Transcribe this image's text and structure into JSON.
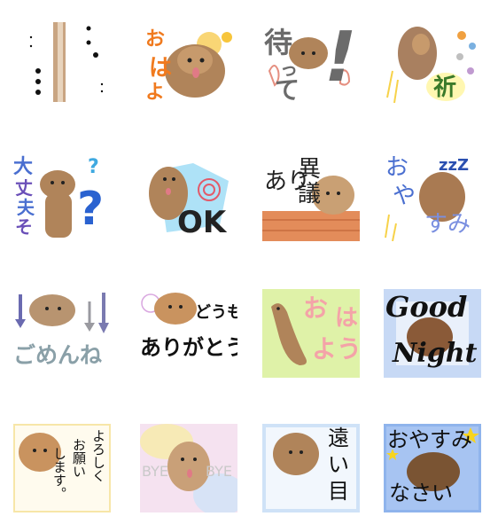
{
  "stickers": [
    {
      "id": "dots",
      "text": []
    },
    {
      "id": "ohayo",
      "text": [
        "お",
        "は",
        "よ"
      ]
    },
    {
      "id": "matte",
      "text": [
        "待",
        "っ",
        "て",
        "!"
      ]
    },
    {
      "id": "inori",
      "text": [
        "祈"
      ]
    },
    {
      "id": "daijoubu",
      "text": [
        "大",
        "丈",
        "夫",
        "そ",
        "?",
        "?"
      ]
    },
    {
      "id": "ok",
      "text": [
        "OK"
      ]
    },
    {
      "id": "igi",
      "text": [
        "異",
        "議",
        "あり"
      ]
    },
    {
      "id": "oyasumi",
      "text": [
        "お",
        "や",
        "すみ",
        "zzZ"
      ]
    },
    {
      "id": "gomenne",
      "text": [
        "ごめんね"
      ]
    },
    {
      "id": "arigatou",
      "text": [
        "どうも",
        "ありがとう"
      ]
    },
    {
      "id": "ohayou2",
      "text": [
        "お",
        "は",
        "よう"
      ]
    },
    {
      "id": "goodnight",
      "text": [
        "Good",
        "Night"
      ]
    },
    {
      "id": "yoroshiku",
      "text": [
        "よろしく",
        "お願い",
        "します。"
      ]
    },
    {
      "id": "byebye",
      "text": [
        "BYE",
        "BYE"
      ]
    },
    {
      "id": "tooime",
      "text": [
        "遠",
        "い",
        "目"
      ]
    },
    {
      "id": "oyasuminasai",
      "text": [
        "おやすみ",
        "なさい"
      ]
    }
  ],
  "colors": {
    "dog": "#b0845a",
    "dog_dark": "#7a5433",
    "ohayo_orange": "#f07a1e",
    "ohayo_yellow": "#f7c53b",
    "blue": "#4a6fd0",
    "purple": "#6a4fb8",
    "gray": "#7c7c7c",
    "green_bg": "#dff2a8",
    "sky": "#9fc9f0"
  },
  "icons": [
    "dog-photo-icon",
    "exclamation-icon",
    "hand-icon",
    "star-icon",
    "sparkle-icon",
    "zzz-icon",
    "arrow-down-icon"
  ]
}
